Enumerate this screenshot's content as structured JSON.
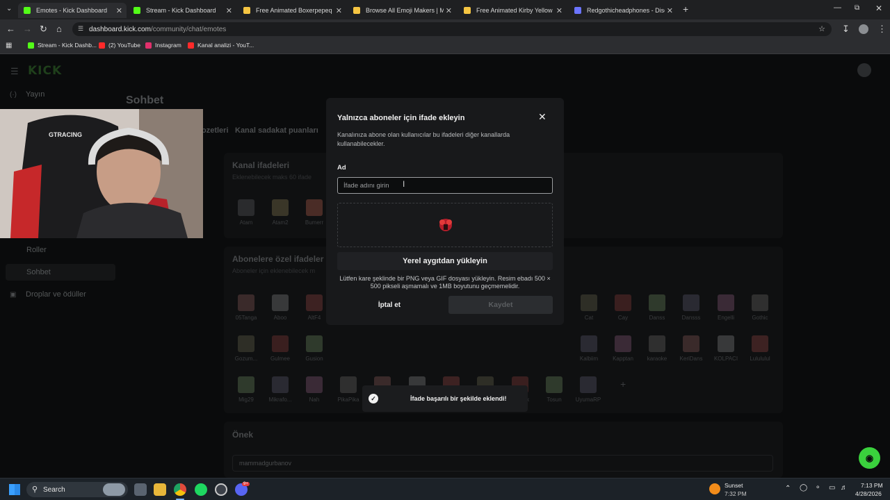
{
  "browser": {
    "tabs": [
      {
        "title": "Emotes - Kick Dashboard",
        "active": true,
        "fav": "#53fc18"
      },
      {
        "title": "Stream - Kick Dashboard",
        "active": false,
        "fav": "#53fc18"
      },
      {
        "title": "Free Animated Boxerpepeq Em",
        "active": false,
        "fav": "#f5c542"
      },
      {
        "title": "Browse All Emoji Makers | Make",
        "active": false,
        "fav": "#f5c542"
      },
      {
        "title": "Free Animated Kirby Yellow Em",
        "active": false,
        "fav": "#f5c542"
      },
      {
        "title": "Redgothicheadphones - Disco",
        "active": false,
        "fav": "#6b74ff"
      }
    ],
    "url_host": "dashboard.kick.com",
    "url_path": "/community/chat/emotes",
    "bookmarks": [
      {
        "label": "Stream - Kick Dashb...",
        "fav": "#53fc18"
      },
      {
        "label": "(2) YouTube",
        "fav": "#ff2a2a"
      },
      {
        "label": "Instagram",
        "fav": "#e1306c"
      },
      {
        "label": "Kanal analizi - YouT...",
        "fav": "#ff2a2a"
      }
    ]
  },
  "dashboard": {
    "logo": "KICK",
    "sidebar": {
      "items": [
        {
          "label": "Yayın",
          "icon": "broadcast-icon"
        },
        {
          "label": "Roller",
          "icon": ""
        },
        {
          "label": "Sohbet",
          "icon": ""
        },
        {
          "label": "Droplar ve ödüller",
          "icon": "gift-icon"
        }
      ]
    },
    "page_title": "Sohbet",
    "subtabs": [
      "ozetleri",
      "Kanal sadakat puanları"
    ],
    "channel_emotes": {
      "title": "Kanal ifadeleri",
      "subtitle": "Eklenebilecek maks 60 ifade",
      "emotes": [
        "Atam",
        "Atam2",
        "Bumerr"
      ]
    },
    "sub_emotes": {
      "title": "Abonelere özel ifadeler",
      "subtitle": "Aboneler için eklenebilecek m",
      "row1": [
        "05Tanga",
        "Aboo",
        "AltF4",
        "Cat",
        "Cay",
        "Danss",
        "Dansss",
        "Engelli",
        "Gothic"
      ],
      "row2": [
        "Gozum...",
        "Gulmee",
        "Gusion",
        "Kalbiim",
        "Kapptan",
        "karaoke",
        "KeriDans",
        "KOLPACI",
        "Lulululul"
      ],
      "row3": [
        "Mig29",
        "Mikrafo...",
        "Nah",
        "PikaPika",
        "Redbull",
        "Sa",
        "Sarli",
        "Saskin",
        "Simsek",
        "Tosun",
        "UyumaRP"
      ]
    },
    "prefix": {
      "title": "Önek",
      "value": "mammadgurbanov"
    }
  },
  "modal": {
    "title": "Yalnızca aboneler için ifade ekleyin",
    "description": "Kanalınıza abone olan kullanıcılar bu ifadeleri diğer kanallarda kullanabilecekler.",
    "name_label": "Ad",
    "name_placeholder": "İfade adını girin",
    "name_value": "",
    "upload_button": "Yerel aygıtdan yükleyin",
    "upload_hint": "Lütfen kare şeklinde bir PNG veya GIF dosyası yükleyin. Resim ebadı 500 × 500 pikseli aşmamalı ve 1MB boyutunu geçmemelidir.",
    "cancel_button": "İptal et",
    "save_button": "Kaydet"
  },
  "toast": {
    "message": "İfade başarılı bir şekilde eklendi!"
  },
  "taskbar": {
    "search_label": "Search",
    "weather_label": "Sunset",
    "weather_time": "7:32 PM",
    "clock_time": "7:13 PM",
    "clock_date": "4/28/2026",
    "discord_badge": "9+"
  },
  "colors": {
    "kick_green": "#53fc18",
    "help_fab": "#3ad13d"
  }
}
